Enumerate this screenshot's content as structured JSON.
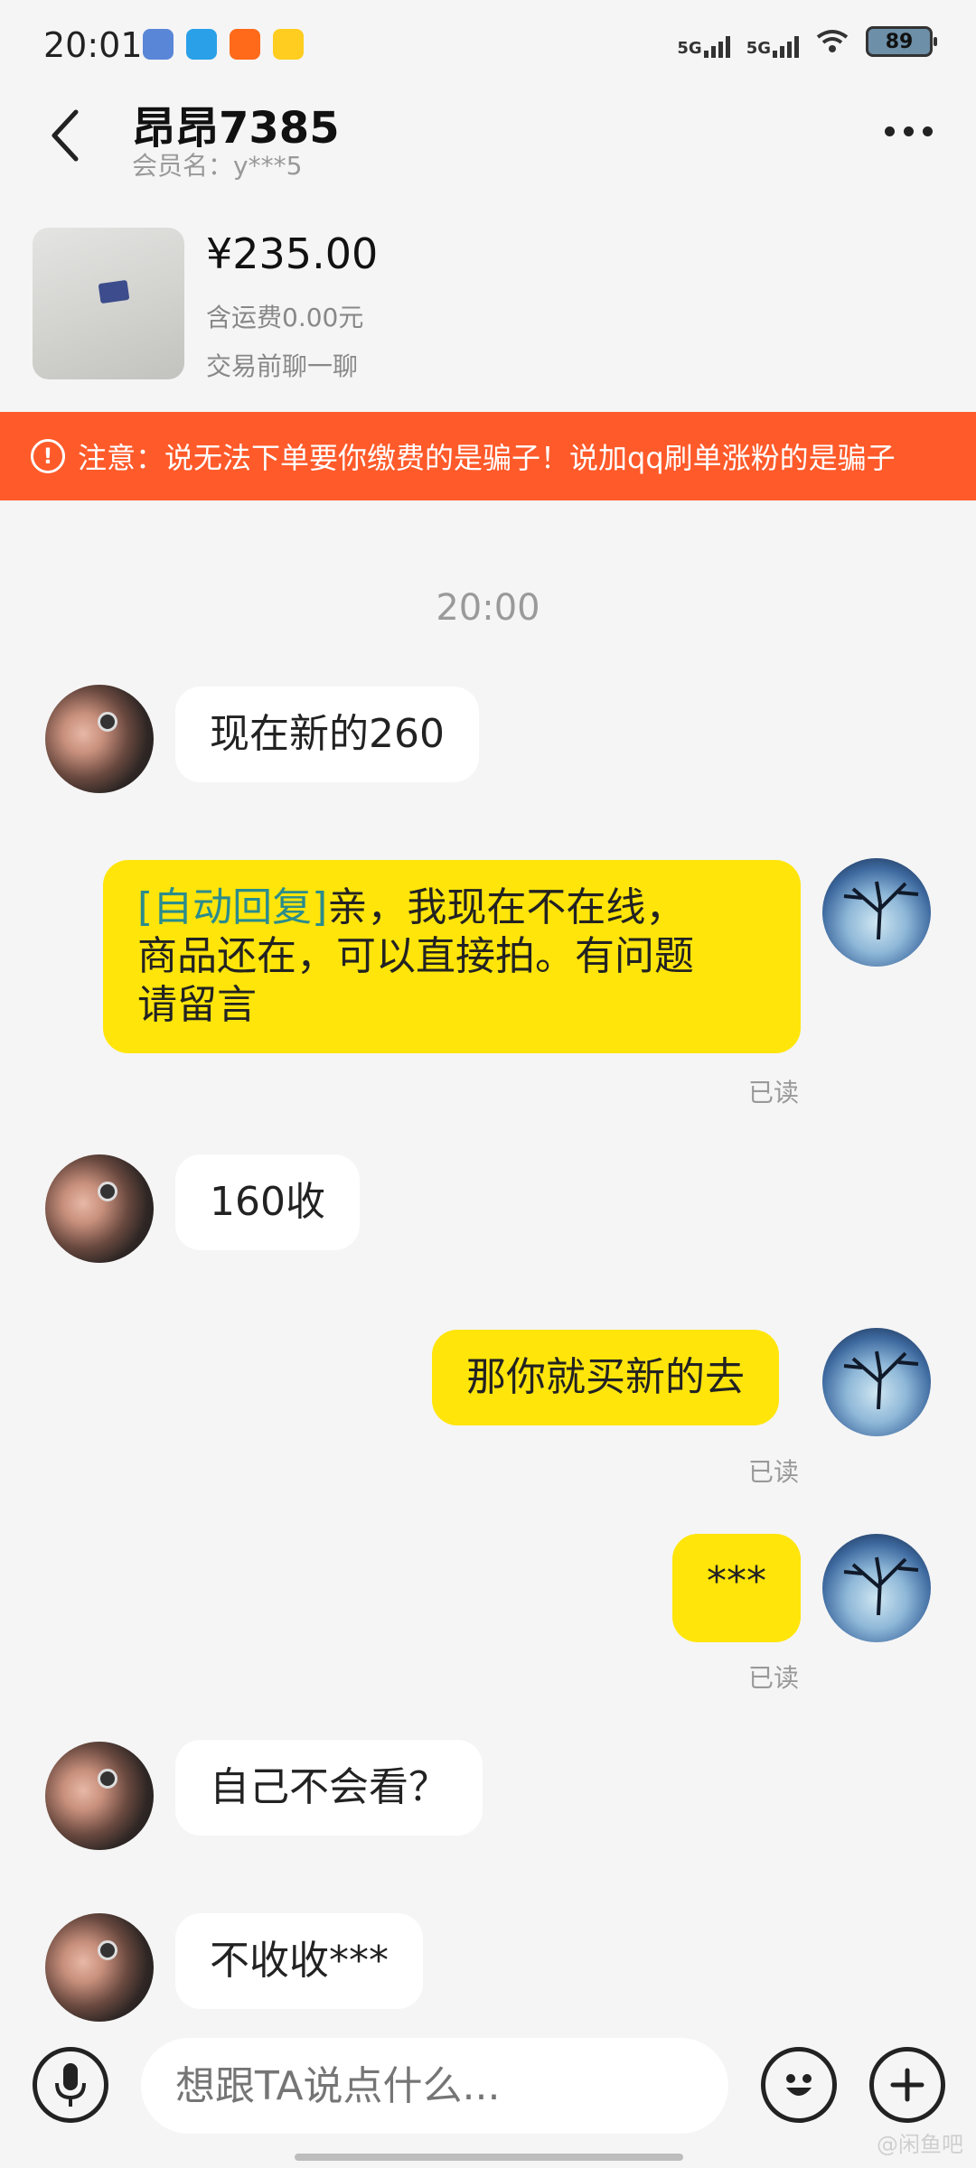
{
  "status_bar": {
    "time": "20:01",
    "signal1": "5G",
    "signal2": "5G",
    "battery": "89"
  },
  "header": {
    "name": "昂昂7385",
    "member": "会员名：y***5"
  },
  "product": {
    "price": "¥235.00",
    "shipping": "含运费0.00元",
    "prechat": "交易前聊一聊"
  },
  "banner": {
    "icon": "!",
    "text": "注意：说无法下单要你缴费的是骗子！说加qq刷单涨粉的是骗子"
  },
  "chat": {
    "timestamp": "20:00",
    "messages": [
      {
        "side": "left",
        "text": "现在新的260"
      },
      {
        "side": "right",
        "tag": "[自动回复]",
        "line1": "亲，我现在不在线，",
        "line2": "商品还在，可以直接拍。有问题",
        "line3": "请留言",
        "status": "已读"
      },
      {
        "side": "left",
        "text": "160收"
      },
      {
        "side": "right",
        "text": "那你就买新的去",
        "status": "已读"
      },
      {
        "side": "right",
        "text": "***",
        "status": "已读"
      },
      {
        "side": "left",
        "text": "自己不会看？"
      },
      {
        "side": "left",
        "text": "不收收***"
      }
    ]
  },
  "input": {
    "placeholder": "想跟TA说点什么..."
  },
  "watermark": "@闲鱼吧",
  "colors": {
    "banner": "#ff5a2a",
    "bubble_right": "#ffe50a",
    "bubble_left": "#ffffff",
    "background": "#f5f5f5"
  },
  "icons": [
    "back-arrow-icon",
    "more-icon",
    "warning-icon",
    "mic-icon",
    "emoji-icon",
    "plus-icon"
  ]
}
